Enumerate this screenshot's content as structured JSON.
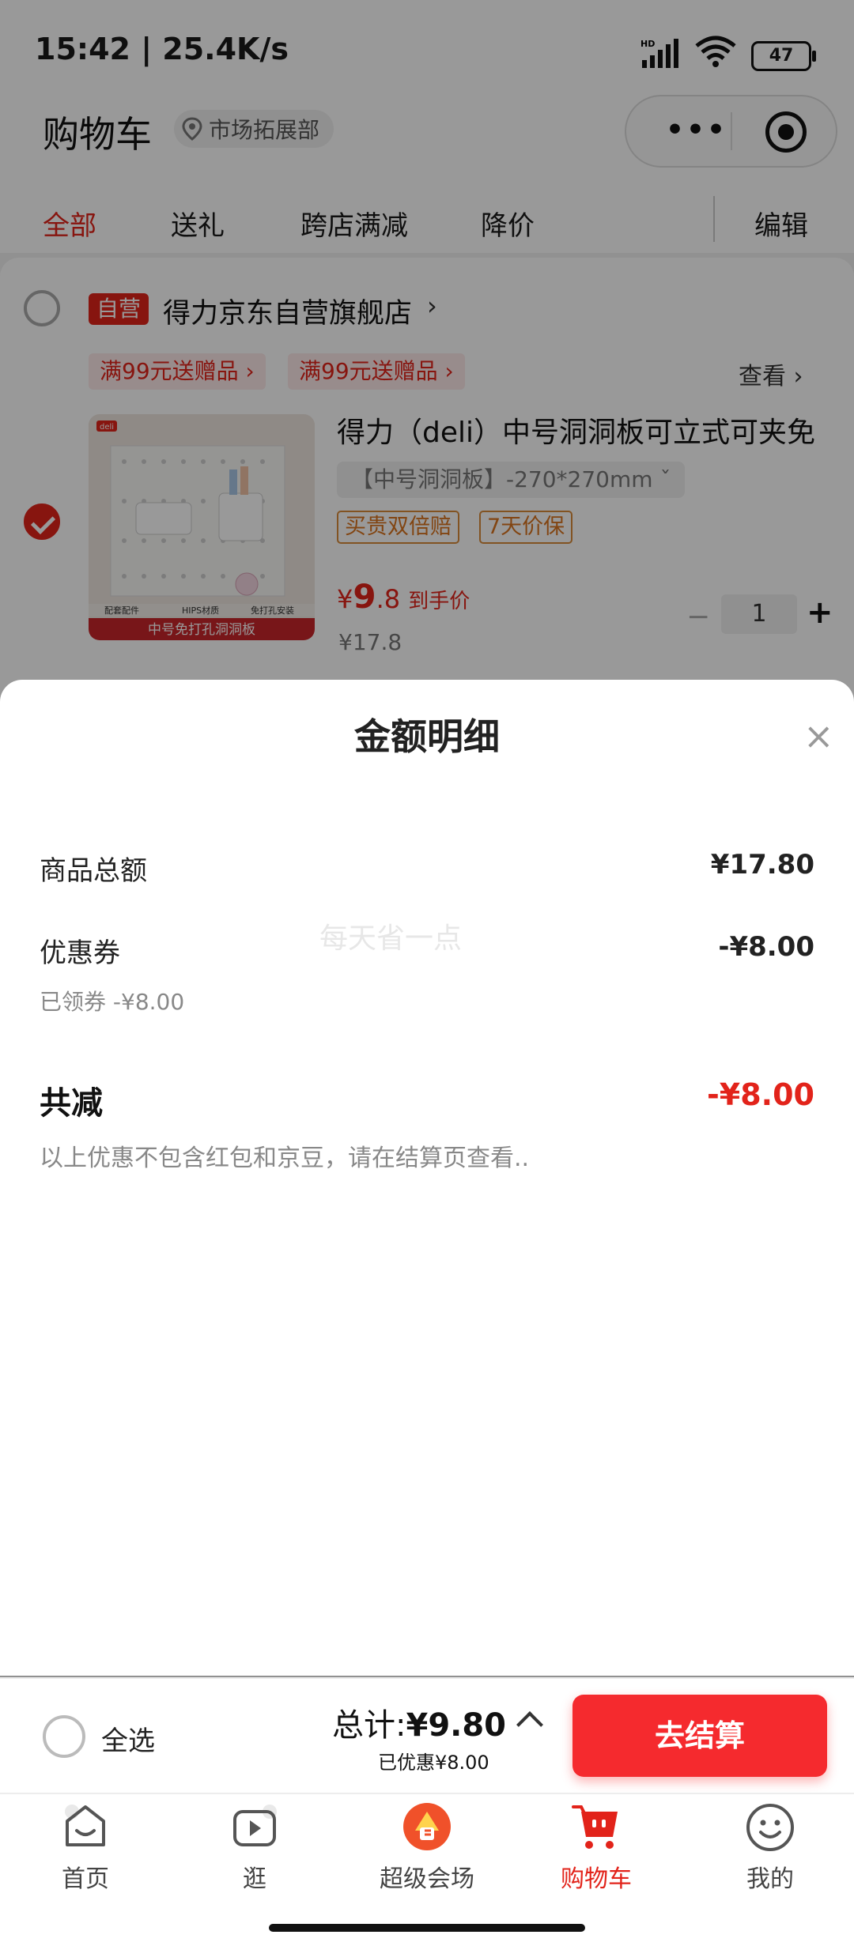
{
  "status_bar": {
    "time": "15:42 | 25.4K/s",
    "battery": "47",
    "icons": [
      "hd-signal-icon",
      "wifi-icon",
      "battery-icon"
    ]
  },
  "header": {
    "title": "购物车",
    "location": "市场拓展部",
    "location_icon": "location-pin-icon",
    "capsule_icons": [
      "more-dots-icon",
      "target-icon"
    ]
  },
  "tabs": [
    {
      "label": "全部",
      "active": true
    },
    {
      "label": "送礼",
      "active": false
    },
    {
      "label": "跨店满减",
      "active": false
    },
    {
      "label": "降价",
      "active": false
    }
  ],
  "edit_label": "编辑",
  "store": {
    "tag": "自营",
    "name": "得力京东自营旗舰店",
    "chevron": "›",
    "promos": [
      "满99元送赠品 ›",
      "满99元送赠品 ›"
    ],
    "view_more": "查看 ›"
  },
  "product": {
    "title": "得力（deli）中号洞洞板可立式可夹免",
    "spec": "【中号洞洞板】-270*270mm  ˇ",
    "badges": [
      "买贵双倍赔",
      "7天价保"
    ],
    "price_symbol": "¥",
    "price_int": "9",
    "price_dec": ".8",
    "price_label": "到手价",
    "original_price": "¥17.8",
    "quantity": "1",
    "minus": "−",
    "plus": "+",
    "image_texts": {
      "logo": "deli",
      "banner": "中号免打孔洞洞板",
      "features": [
        "配套配件",
        "HIPS材质",
        "免打孔安装"
      ]
    }
  },
  "sheet": {
    "title": "金额明细",
    "close": "×",
    "rows": [
      {
        "label": "商品总额",
        "value": "¥17.80"
      },
      {
        "label": "优惠券",
        "value": "-¥8.00",
        "sub": "已领券 -¥8.00"
      }
    ],
    "watermark": "每天省一点",
    "total_label": "共减",
    "total_value": "-¥8.00",
    "note": "以上优惠不包含红包和京豆，请在结算页查看.."
  },
  "checkout": {
    "select_all": "全选",
    "total_prefix": "总计:",
    "total_amount": "¥9.80",
    "discount": "已优惠¥8.00",
    "button": "去结算"
  },
  "nav": [
    {
      "label": "首页",
      "icon": "home-icon",
      "active": false
    },
    {
      "label": "逛",
      "icon": "video-play-icon",
      "active": false
    },
    {
      "label": "超级会场",
      "icon": "super-venue-icon",
      "active": false
    },
    {
      "label": "购物车",
      "icon": "cart-icon",
      "active": true
    },
    {
      "label": "我的",
      "icon": "profile-smile-icon",
      "active": false
    }
  ],
  "colors": {
    "accent": "#e2231a",
    "button": "#f52a2e",
    "mask": "rgba(0,0,0,0.4)"
  }
}
